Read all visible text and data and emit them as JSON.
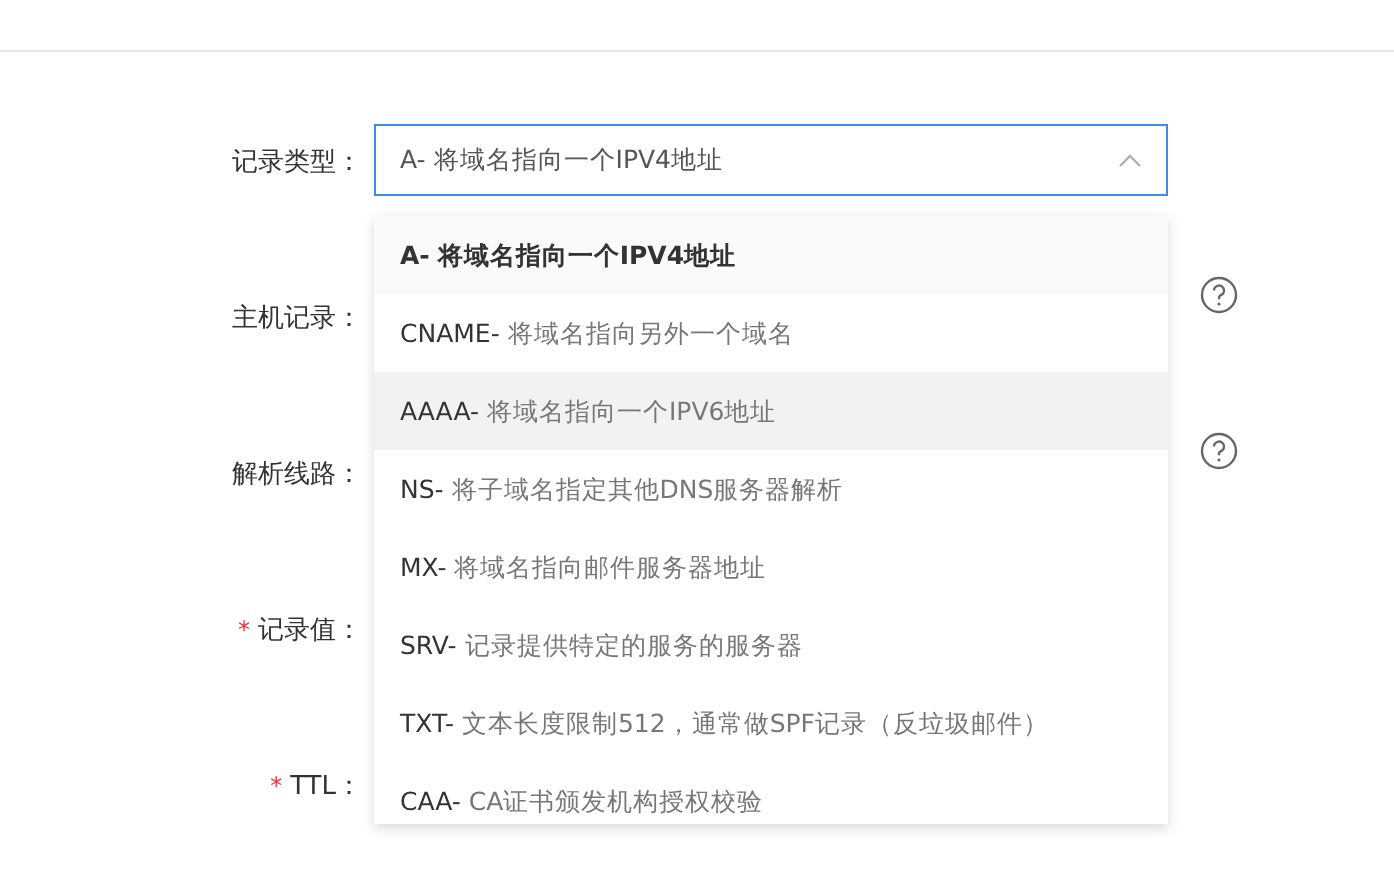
{
  "form": {
    "rows": [
      {
        "label": "记录类型：",
        "help": false
      },
      {
        "label": "主机记录：",
        "help": true
      },
      {
        "label": "解析线路：",
        "help": true
      },
      {
        "label": "记录值：",
        "required_mark": "*",
        "help": false
      },
      {
        "label": "TTL：",
        "required_mark": "*",
        "help": false
      }
    ]
  },
  "select": {
    "value": "A- 将域名指向一个IPV4地址",
    "expanded": true
  },
  "options": [
    {
      "code": "A-",
      "description": "将域名指向一个IPV4地址",
      "selected": true,
      "highlighted": false
    },
    {
      "code": "CNAME-",
      "description": "将域名指向另外一个域名",
      "selected": false,
      "highlighted": false
    },
    {
      "code": "AAAA-",
      "description": "将域名指向一个IPV6地址",
      "selected": false,
      "highlighted": true
    },
    {
      "code": "NS-",
      "description": "将子域名指定其他DNS服务器解析",
      "selected": false,
      "highlighted": false
    },
    {
      "code": "MX-",
      "description": "将域名指向邮件服务器地址",
      "selected": false,
      "highlighted": false
    },
    {
      "code": "SRV-",
      "description": "记录提供特定的服务的服务器",
      "selected": false,
      "highlighted": false
    },
    {
      "code": "TXT-",
      "description": "文本长度限制512，通常做SPF记录（反垃圾邮件）",
      "selected": false,
      "highlighted": false
    },
    {
      "code": "CAA-",
      "description": "CA证书颁发机构授权校验",
      "selected": false,
      "highlighted": false
    }
  ]
}
